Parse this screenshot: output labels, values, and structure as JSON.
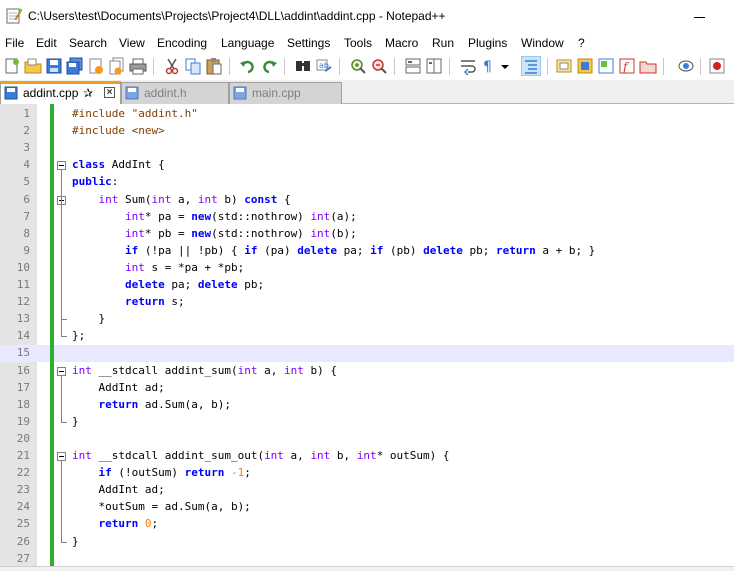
{
  "window": {
    "title": "C:\\Users\\test\\Documents\\Projects\\Project4\\DLL\\addint\\addint.cpp - Notepad++"
  },
  "menu": [
    "File",
    "Edit",
    "Search",
    "View",
    "Encoding",
    "Language",
    "Settings",
    "Tools",
    "Macro",
    "Run",
    "Plugins",
    "Window",
    "?"
  ],
  "toolbar_icons": [
    "new-file-icon",
    "open-file-icon",
    "save-icon",
    "save-all-icon",
    "close-file-icon",
    "close-all-icon",
    "print-icon",
    "cut-icon",
    "copy-icon",
    "paste-icon",
    "undo-icon",
    "redo-icon",
    "find-icon",
    "replace-icon",
    "zoom-in-icon",
    "zoom-out-icon",
    "sync-vertical-icon",
    "sync-horizontal-icon",
    "word-wrap-icon",
    "show-all-chars-icon",
    "indent-guide-icon",
    "user-lang-icon",
    "doc-map-icon",
    "function-list-icon",
    "folder-workspace-icon",
    "doc-list-icon",
    "monitoring-icon",
    "record-macro-icon"
  ],
  "tabs": [
    {
      "label": "addint.cpp",
      "active": true
    },
    {
      "label": "addint.h",
      "active": false
    },
    {
      "label": "main.cpp",
      "active": false
    }
  ],
  "tab_pin_glyph": "✰",
  "tab_close_glyph": "×",
  "colors": {
    "keyword": "#0000ff",
    "type": "#8000ff",
    "preprocessor": "#804000",
    "number": "#ff8000",
    "tab_accent": "#f39c1f",
    "change_bar": "#2fae2f",
    "current_line": "#e8e8ff"
  },
  "code_lines": [
    "#include \"addint.h\"",
    "#include <new>",
    "",
    "class AddInt {",
    "public:",
    "    int Sum(int a, int b) const {",
    "        int* pa = new(std::nothrow) int(a);",
    "        int* pb = new(std::nothrow) int(b);",
    "        if (!pa || !pb) { if (pa) delete pa; if (pb) delete pb; return a + b; }",
    "        int s = *pa + *pb;",
    "        delete pa; delete pb;",
    "        return s;",
    "    }",
    "};",
    "",
    "int __stdcall addint_sum(int a, int b) {",
    "    AddInt ad;",
    "    return ad.Sum(a, b);",
    "}",
    "",
    "int __stdcall addint_sum_out(int a, int b, int* outSum) {",
    "    if (!outSum) return -1;",
    "    AddInt ad;",
    "    *outSum = ad.Sum(a, b);",
    "    return 0;",
    "}",
    ""
  ],
  "current_line": 15
}
